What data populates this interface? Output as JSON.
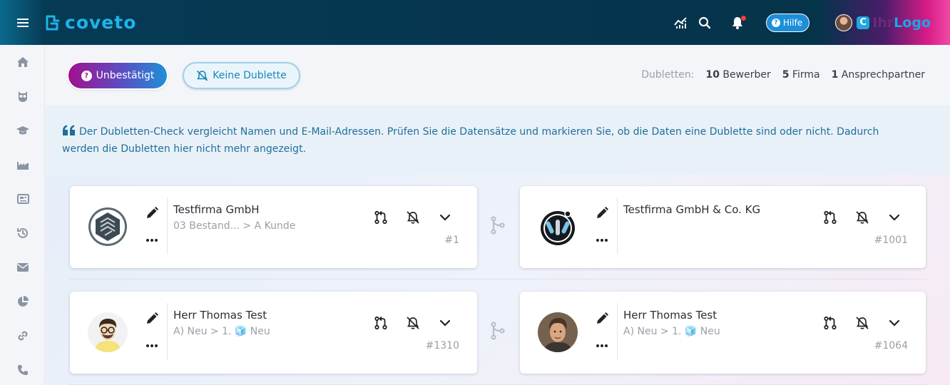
{
  "app": {
    "logo_text": "coveto",
    "brand_text_a": "Ihr",
    "brand_text_b": "Logo",
    "brand_mark": "C"
  },
  "header": {
    "help_label": "Hilfe",
    "icons": [
      "menu-icon",
      "chart-icon",
      "search-icon",
      "bell-icon"
    ]
  },
  "sidebar": {
    "items": [
      "home-icon",
      "owl-icon",
      "graduation-icon",
      "factory-icon",
      "newspaper-icon",
      "history-icon",
      "mail-icon",
      "pie-chart-icon",
      "link-icon",
      "phone-icon"
    ]
  },
  "toolbar": {
    "unconfirmed_label": "Unbestätigt",
    "no_duplicate_label": "Keine Dublette",
    "stats_label": "Dubletten:",
    "stats": [
      {
        "count": "10",
        "label": "Bewerber"
      },
      {
        "count": "5",
        "label": "Firma"
      },
      {
        "count": "1",
        "label": "Ansprechpartner"
      }
    ]
  },
  "info": {
    "text": "Der Dubletten-Check vergleicht Namen und E-Mail-Adressen. Prüfen Sie die Datensätze und markieren Sie, ob die Daten eine Dublette sind oder nicht. Dadurch werden die Dubletten hier nicht mehr angezeigt."
  },
  "pairs": [
    {
      "left": {
        "name": "Testfirma GmbH",
        "sub": "03 Bestand... > A Kunde",
        "id": "#1"
      },
      "right": {
        "name": "Testfirma GmbH & Co. KG",
        "sub": "",
        "id": "#1001"
      }
    },
    {
      "left": {
        "name": "Herr Thomas Test",
        "sub": "A) Neu > 1. 🧊 Neu",
        "id": "#1310"
      },
      "right": {
        "name": "Herr Thomas Test",
        "sub": "A) Neu > 1. 🧊 Neu",
        "id": "#1064"
      }
    }
  ]
}
